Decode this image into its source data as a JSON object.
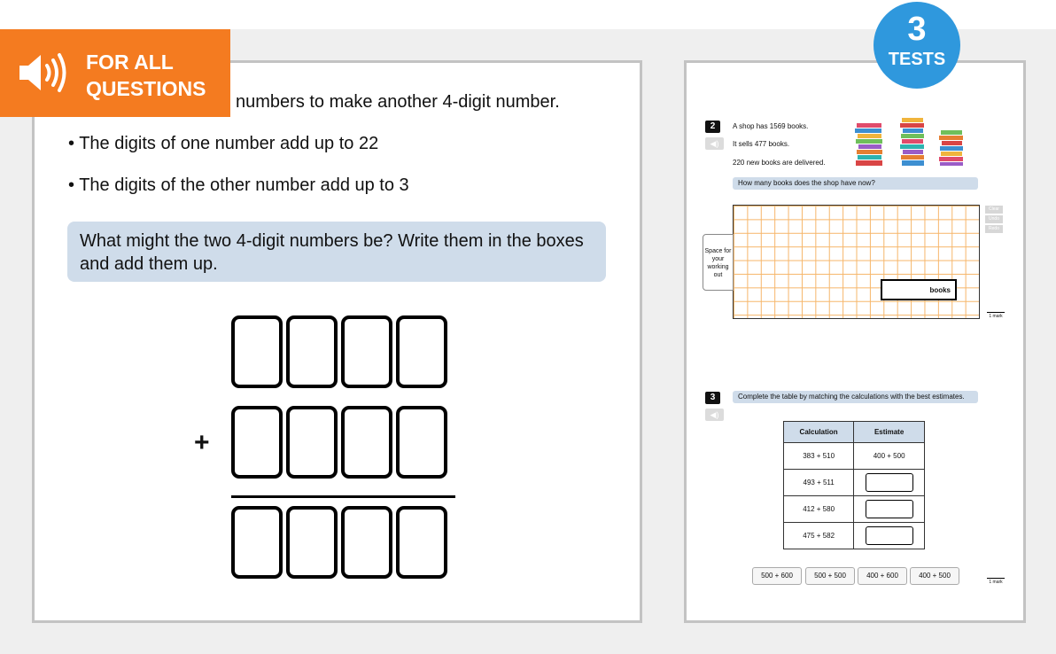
{
  "banner": {
    "label_line1": "FOR ALL",
    "label_line2": "QUESTIONS",
    "icon": "speaker-icon",
    "color": "#f47b20"
  },
  "badge": {
    "number": "3",
    "label": "TESTS",
    "color": "#2f98dd"
  },
  "left_question": {
    "line1": "numbers to make another 4-digit number.",
    "bullets": [
      "• The digits of one number add up to 22",
      "• The digits of the other number add up to 3"
    ],
    "prompt": "What might the two 4-digit numbers be? Write them in the boxes and add them up.",
    "plus": "+"
  },
  "right_page": {
    "q2": {
      "number": "2",
      "lines": [
        "A shop has 1569 books.",
        "It sells 477 books.",
        "220 new books are delivered."
      ],
      "question": "How many books does the shop have now?",
      "working_label": "Space for your working out",
      "answer_unit": "books",
      "side_buttons": [
        "Clear",
        "Undo",
        "Redo"
      ],
      "mark": "1 mark"
    },
    "q3": {
      "number": "3",
      "question": "Complete the table by matching the calculations with the best estimates.",
      "table": {
        "headers": [
          "Calculation",
          "Estimate"
        ],
        "rows": [
          {
            "calc": "383 + 510",
            "estimate": "400 + 500"
          },
          {
            "calc": "493 + 511",
            "estimate": ""
          },
          {
            "calc": "412 + 580",
            "estimate": ""
          },
          {
            "calc": "475 + 582",
            "estimate": ""
          }
        ]
      },
      "choices": [
        "500 + 600",
        "500 + 500",
        "400 + 600",
        "400 + 500"
      ],
      "mark": "1 mark"
    }
  }
}
